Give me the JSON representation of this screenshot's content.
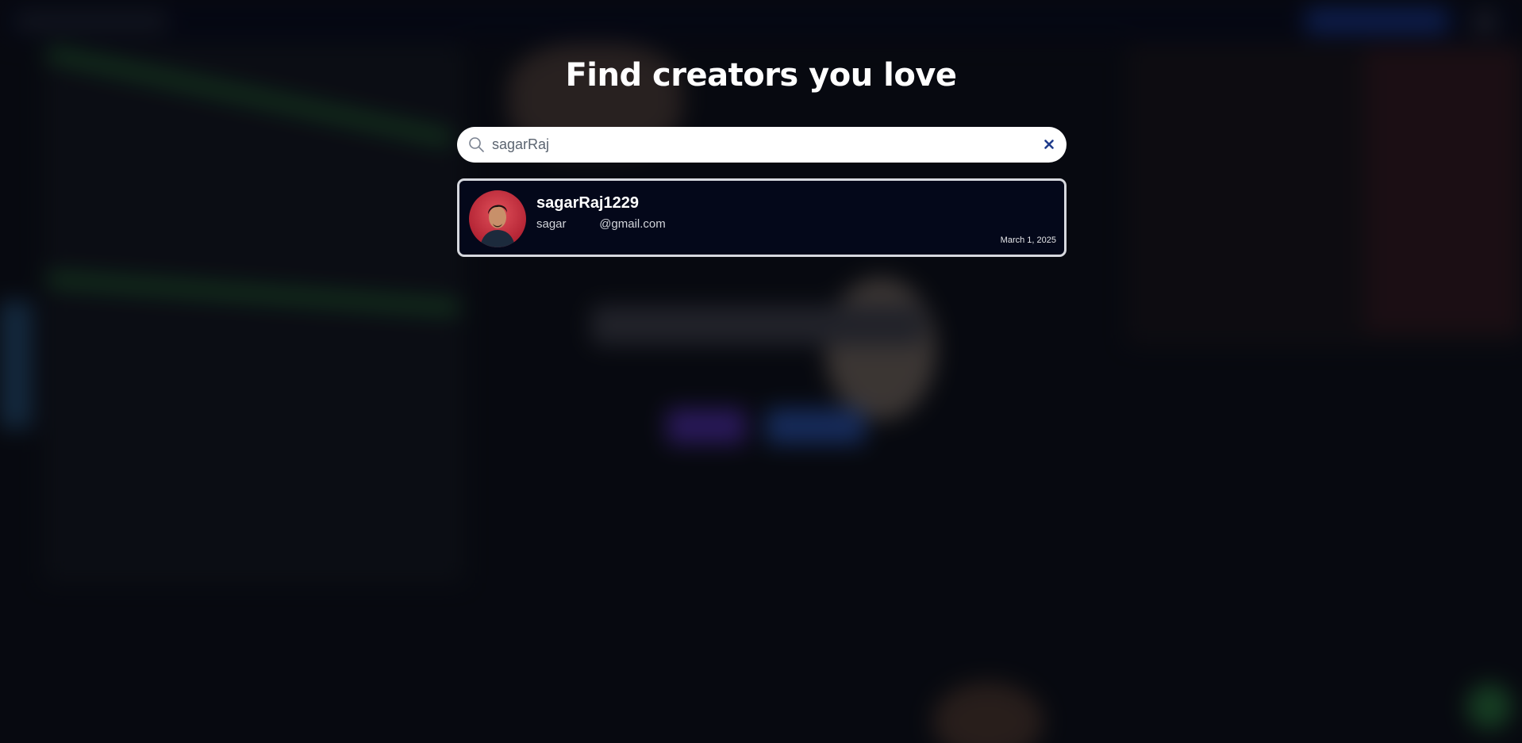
{
  "page": {
    "title": "Find creators you love"
  },
  "search": {
    "value": "sagarRaj",
    "clear_icon": "close-icon",
    "search_icon": "search-icon"
  },
  "results": [
    {
      "username": "sagarRaj1229",
      "email": "sagar          @gmail.com",
      "joined": "March 1, 2025",
      "avatar_icon": "avatar-photo"
    }
  ],
  "colors": {
    "title": "#ffffff",
    "card_background": "#04081a",
    "card_border": "#d6d8de",
    "clear_icon": "#1f3c8c",
    "background": "#0b0d12"
  }
}
